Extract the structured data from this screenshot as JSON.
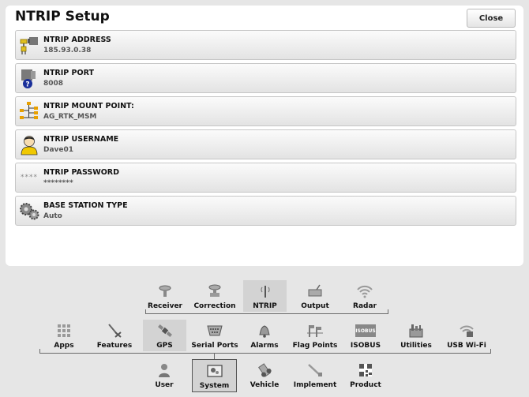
{
  "title": "NTRIP Setup",
  "close_label": "Close",
  "rows": [
    {
      "label": "NTRIP ADDRESS",
      "value": "185.93.0.38"
    },
    {
      "label": "NTRIP PORT",
      "value": "8008"
    },
    {
      "label": "NTRIP MOUNT POINT:",
      "value": "AG_RTK_MSM"
    },
    {
      "label": "NTRIP USERNAME",
      "value": "Dave01"
    },
    {
      "label": "NTRIP PASSWORD",
      "value": "********"
    },
    {
      "label": "BASE STATION TYPE",
      "value": "Auto"
    }
  ],
  "gps_tabs": [
    "Receiver",
    "Correction",
    "NTRIP",
    "Output",
    "Radar"
  ],
  "main_tabs": [
    "Apps",
    "Features",
    "GPS",
    "Serial Ports",
    "Alarms",
    "Flag Points",
    "ISOBUS",
    "Utilities",
    "USB Wi-Fi"
  ],
  "system_tabs": [
    "User",
    "System",
    "Vehicle",
    "Implement",
    "Product"
  ],
  "isobus_icon_text": "ISOBUS",
  "password_icon_text": "****"
}
